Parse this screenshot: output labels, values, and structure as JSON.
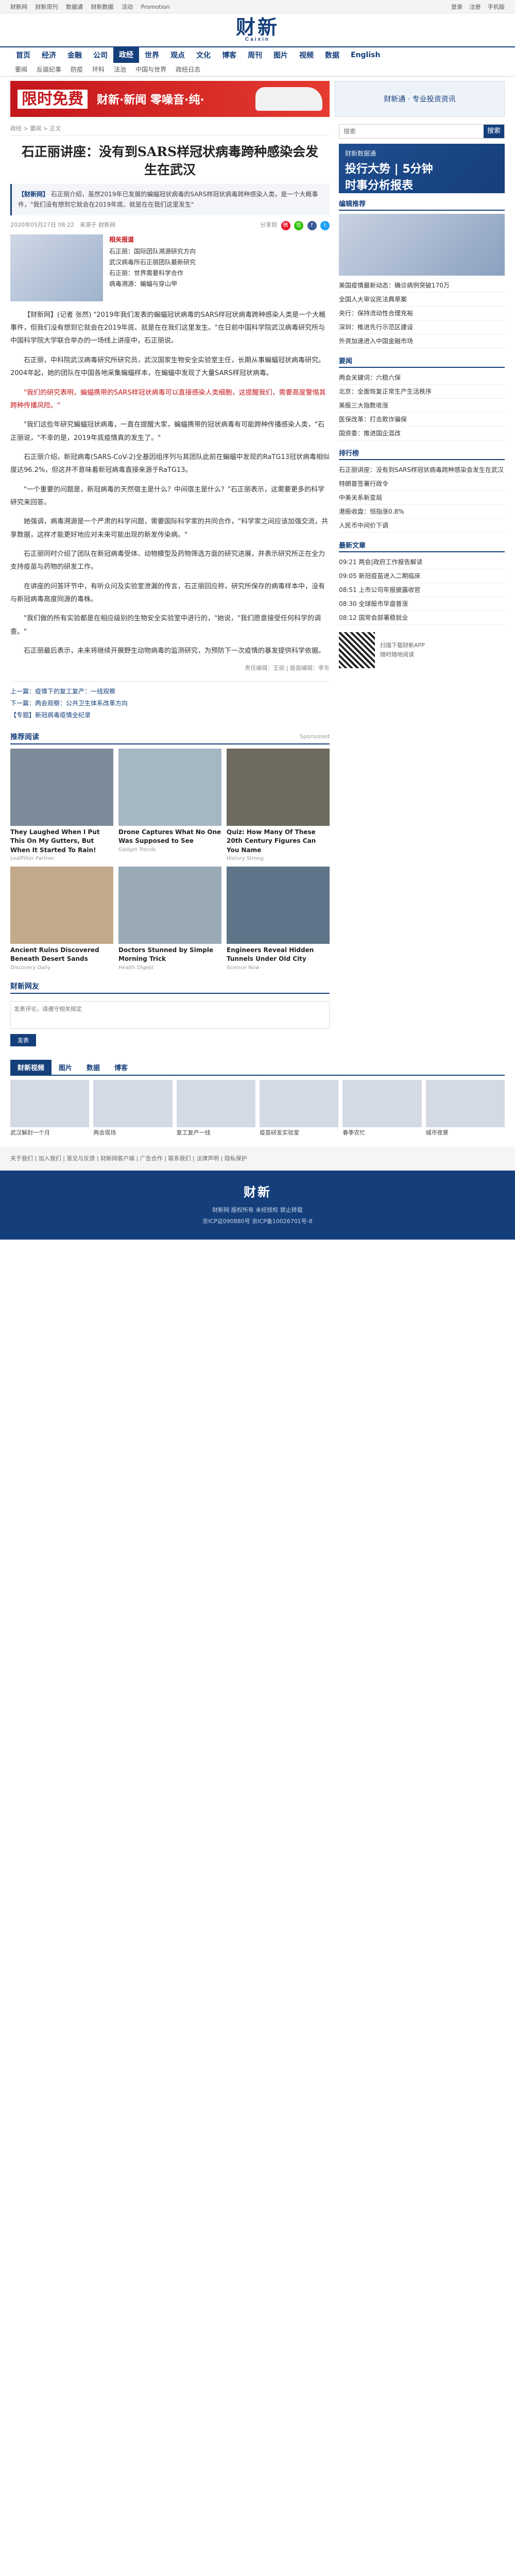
{
  "topbar": {
    "links": [
      "财新网",
      "财新周刊",
      "数据通",
      "财新数据",
      "活动",
      "Promotion"
    ],
    "right": [
      "登录",
      "注册",
      "手机版"
    ]
  },
  "logo": {
    "cn": "财新",
    "en": "Caixin"
  },
  "nav": {
    "main": [
      "首页",
      "经济",
      "金融",
      "公司",
      "政经",
      "世界",
      "观点",
      "文化",
      "博客",
      "周刊",
      "图片",
      "视频",
      "数据",
      "English"
    ],
    "active_index": 4,
    "sub": [
      "要闻",
      "反腐纪事",
      "防疫",
      "环科",
      "法治",
      "中国与世界",
      "政经日志"
    ]
  },
  "ad": {
    "big": "限时免费",
    "mid": "财新·新闻  零噪音·纯·",
    "side": "财新通 · 专业投资资讯"
  },
  "article": {
    "breadcrumb": "政经 > 要闻 > 正文",
    "title": "石正丽讲座：没有到SARS样冠状病毒跨种感染会发生在武汉",
    "summary_label": "【财新网】",
    "summary": "石正丽介绍，虽然2019年已发展的蝙蝠冠状病毒的SARS样冠状病毒跨种感染人类，是一个大概事件，\"我们没有想到它就会在2019年底、就是在在我们这里发生\"",
    "meta_time": "2020年05月27日 08:22",
    "meta_source": "来源于 财新网",
    "share_label": "分享到",
    "related_head": "相关报道",
    "related": [
      "石正丽：国际团队溯源研究方向",
      "武汉病毒所石正丽团队最新研究",
      "石正丽：世界需要科学合作",
      "病毒溯源：蝙蝠与穿山甲"
    ],
    "paragraphs": [
      "【财新网】(记者 张然) \"2019年我们发表的蝙蝠冠状病毒的SARS样冠状病毒跨种感染人类是一个大概事件，但我们没有想到它就会在2019年底、就是在在我们这里发生。\"在日前中国科学院武汉病毒研究所与中国科学院大学联合举办的一场线上讲座中，石正丽说。",
      "石正丽，中科院武汉病毒研究所研究员，武汉国家生物安全实验室主任，长期从事蝙蝠冠状病毒研究。2004年起，她的团队在中国各地采集蝙蝠样本，在蝙蝠中发现了大量SARS样冠状病毒。",
      "\"我们这些年研究蝙蝠冠状病毒，一直在提醒大家，蝙蝠携带的冠状病毒有可能跨种传播感染人类，\"石正丽说，\"不幸的是，2019年底疫情真的发生了。\"",
      "石正丽介绍，新冠病毒(SARS-CoV-2)全基因组序列与其团队此前在蝙蝠中发现的RaTG13冠状病毒相似度达96.2%，但这并不意味着新冠病毒直接来源于RaTG13。",
      "\"一个重要的问题是，新冠病毒的天然宿主是什么？中间宿主是什么？\"石正丽表示，这需要更多的科学研究来回答。",
      "她强调，病毒溯源是一个严肃的科学问题，需要国际科学家的共同合作，\"科学家之间应该加强交流，共享数据，这样才能更好地应对未来可能出现的新发传染病。\"",
      "石正丽同时介绍了团队在新冠病毒受体、动物模型及药物筛选方面的研究进展，并表示研究所正在全力支持疫苗与药物的研发工作。",
      "在讲座的问答环节中，有听众问及实验室泄漏的传言，石正丽回应称，研究所保存的病毒样本中，没有与新冠病毒高度同源的毒株。",
      "\"我们做的所有实验都是在相应级别的生物安全实验室中进行的，\"她说，\"我们愿意接受任何科学的调查。\"",
      "石正丽最后表示，未来将继续开展野生动物病毒的监测研究，为预防下一次疫情的暴发提供科学依据。"
    ],
    "highlight_paragraph": "\"我们的研究表明，蝙蝠携带的SARS样冠状病毒可以直接感染人类细胞，这提醒我们，需要高度警惕其跨种传播风险。\"",
    "editor": "责任编辑：王丽  | 版面编辑：李东",
    "more_links": [
      "上一篇：疫情下的复工复产：一线观察",
      "下一篇：两会观察：公共卫生体系改革方向",
      "【专题】新冠病毒疫情全纪录"
    ]
  },
  "recommend": {
    "head": "推荐阅读",
    "more": "Sponsored",
    "cards": [
      {
        "title": "They Laughed When I Put This On My Gutters, But When It Started To Rain!",
        "source": "LeafFilter Partner"
      },
      {
        "title": "Drone Captures What No One Was Supposed to See",
        "source": "Gadget Trends"
      },
      {
        "title": "Quiz: How Many Of These 20th Century Figures Can You Name",
        "source": "History Strong"
      },
      {
        "title": "Ancient Ruins Discovered Beneath Desert Sands",
        "source": "Discovery Daily"
      },
      {
        "title": "Doctors Stunned by Simple Morning Trick",
        "source": "Health Digest"
      },
      {
        "title": "Engineers Reveal Hidden Tunnels Under Old City",
        "source": "Science Now"
      }
    ]
  },
  "comments": {
    "head": "财新网友",
    "placeholder": "发表评论，请遵守相关规定",
    "submit": "发表"
  },
  "side": {
    "search_placeholder": "搜索",
    "search_btn": "搜索",
    "ad_l1": "财新数据通",
    "ad_l2": "投行大势 | 5分钟",
    "ad_l3": "时事分析报表",
    "blocks": [
      {
        "head": "编辑推荐",
        "items": [
          "美国疫情最新动态：确诊病例突破170万",
          "全国人大审议民法典草案",
          "央行：保持流动性合理充裕",
          "深圳：推进先行示范区建设",
          "外资加速进入中国金融市场"
        ]
      },
      {
        "head": "要闻",
        "items": [
          "两会关键词：六稳六保",
          "北京：全面恢复正常生产生活秩序",
          "美股三大指数收涨",
          "医保改革：打击欺诈骗保",
          "国资委：推进国企混改"
        ]
      },
      {
        "head": "排行榜",
        "items": [
          "石正丽讲座：没有到SARS样冠状病毒跨种感染会发生在武汉",
          "特朗普签署行政令",
          "中美关系新变局",
          "港股收盘：恒指涨0.8%",
          "人民币中间价下调"
        ]
      },
      {
        "head": "最新文章",
        "items": [
          "09:21 两会|政府工作报告解读",
          "09:05 新冠疫苗进入二期临床",
          "08:51 上市公司年报披露收官",
          "08:30 全球股市早盘普涨",
          "08:12 国常会部署稳就业"
        ]
      }
    ],
    "qr_text": "扫描下载财新APP\n随时随地阅读"
  },
  "fulltabs": {
    "tabs": [
      "财新视频",
      "图片",
      "数据",
      "博客"
    ],
    "pics": [
      "武汉解封一个月",
      "两会现场",
      "复工复产一线",
      "疫苗研发实验室",
      "春季农忙",
      "城市夜景"
    ]
  },
  "footer": {
    "links": "关于我们 | 加入我们 | 意见与反馈 | 财新网客户端 | 广告合作 | 联系我们 | 法律声明 | 隐私保护",
    "logo": "财新",
    "copyright": "财新网 版权所有 未经授权 禁止转载",
    "icp": "京ICP证090880号 京ICP备10026701号-8"
  }
}
